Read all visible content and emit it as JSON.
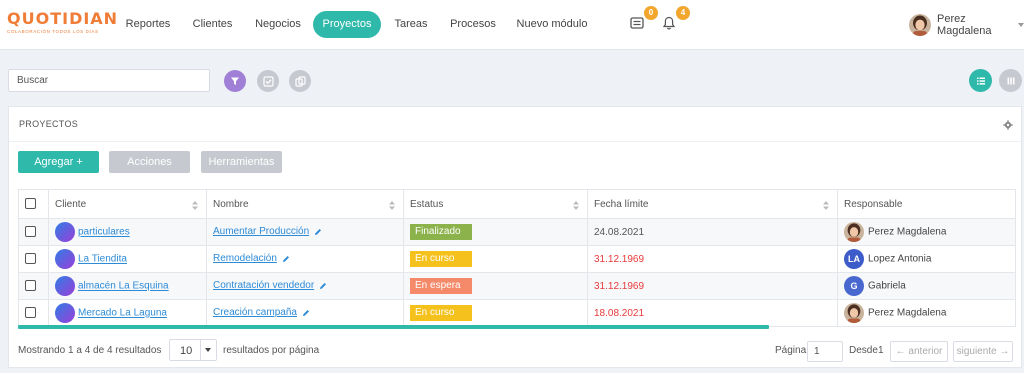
{
  "header": {
    "logo_text": "QUOTIDIAN",
    "logo_tagline": "COLABORACIÓN TODOS LOS DÍAS",
    "nav": [
      {
        "label": "Reportes",
        "active": false
      },
      {
        "label": "Clientes",
        "active": false
      },
      {
        "label": "Negocios",
        "active": false
      },
      {
        "label": "Proyectos",
        "active": true
      },
      {
        "label": "Tareas",
        "active": false
      },
      {
        "label": "Procesos",
        "active": false
      },
      {
        "label": "Nuevo módulo",
        "active": false
      }
    ],
    "messages_badge": "0",
    "notifications_badge": "4",
    "user_name": "Perez Magdalena"
  },
  "toolbar": {
    "search_placeholder": "Buscar",
    "icons": [
      "filter-icon",
      "checkbox-icon",
      "copy-icon",
      "list-view-icon",
      "column-view-icon"
    ]
  },
  "panel": {
    "title": "PROYECTOS",
    "buttons": {
      "add": "Agregar +",
      "actions": "Acciones",
      "tools": "Herramientas"
    }
  },
  "table": {
    "columns": [
      "Cliente",
      "Nombre",
      "Estatus",
      "Fecha límite",
      "Responsable"
    ],
    "rows": [
      {
        "client": "particulares",
        "name": "Aumentar Producción",
        "status": "Finalizado",
        "status_color": "#8bb24b",
        "date": "24.08.2021",
        "date_overdue": false,
        "responsible": "Perez Magdalena",
        "resp_avatar": "photo"
      },
      {
        "client": "La Tiendita",
        "name": "Remodelación",
        "status": "En curso",
        "status_color": "#f5c11d",
        "date": "31.12.1969",
        "date_overdue": true,
        "responsible": "Lopez Antonia",
        "resp_avatar": "LA"
      },
      {
        "client": "almacén La Esquina",
        "name": "Contratación vendedor",
        "status": "En espera",
        "status_color": "#f48a6a",
        "date": "31.12.1969",
        "date_overdue": true,
        "responsible": "Gabriela",
        "resp_avatar": "G"
      },
      {
        "client": "Mercado La Laguna",
        "name": "Creación campaña",
        "status": "En curso",
        "status_color": "#f5c11d",
        "date": "18.08.2021",
        "date_overdue": true,
        "responsible": "Perez Magdalena",
        "resp_avatar": "photo"
      }
    ]
  },
  "footer": {
    "showing": "Mostrando 1 a 4 de 4 resultados",
    "per_page_value": "10",
    "per_page_label": "resultados por página",
    "page_label": "Página",
    "page_value": "1",
    "of_label": "Desde",
    "total_pages": "1",
    "prev": "← anterior",
    "next": "siguiente →"
  },
  "colors": {
    "accent": "#2fb9ab",
    "filter": "#a07fd6",
    "badge": "#f3a62e",
    "link": "#2e8bd6",
    "overdue": "#e63a3a"
  }
}
